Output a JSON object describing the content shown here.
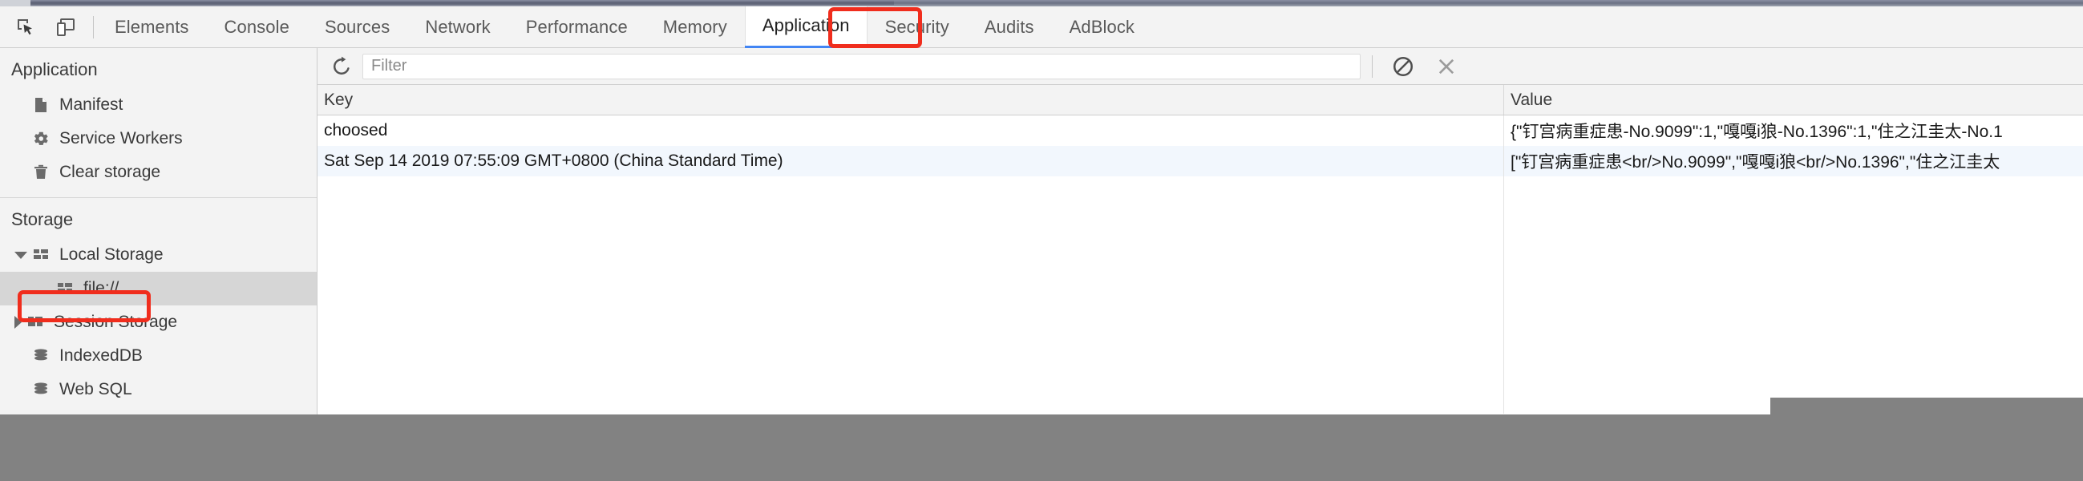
{
  "toolbar": {
    "inspect_icon": "inspect-element-icon",
    "device_icon": "toggle-device-toolbar-icon"
  },
  "tabs": [
    {
      "label": "Elements",
      "selected": false
    },
    {
      "label": "Console",
      "selected": false
    },
    {
      "label": "Sources",
      "selected": false
    },
    {
      "label": "Network",
      "selected": false
    },
    {
      "label": "Performance",
      "selected": false
    },
    {
      "label": "Memory",
      "selected": false
    },
    {
      "label": "Application",
      "selected": true
    },
    {
      "label": "Security",
      "selected": false
    },
    {
      "label": "Audits",
      "selected": false
    },
    {
      "label": "AdBlock",
      "selected": false
    }
  ],
  "sidebar": {
    "application": {
      "title": "Application",
      "items": [
        {
          "label": "Manifest",
          "icon": "document-icon"
        },
        {
          "label": "Service Workers",
          "icon": "gear-icon"
        },
        {
          "label": "Clear storage",
          "icon": "trash-icon"
        }
      ]
    },
    "storage": {
      "title": "Storage",
      "items": [
        {
          "label": "Local Storage",
          "icon": "table-icon",
          "twisty": "open",
          "child": false,
          "selected": false
        },
        {
          "label": "file://",
          "icon": "table-icon",
          "twisty": "none",
          "child": true,
          "selected": true
        },
        {
          "label": "Session Storage",
          "icon": "table-icon",
          "twisty": "closed",
          "child": false,
          "selected": false
        },
        {
          "label": "IndexedDB",
          "icon": "database-icon",
          "twisty": "none",
          "child": false,
          "selected": false
        },
        {
          "label": "Web SQL",
          "icon": "database-icon",
          "twisty": "none",
          "child": false,
          "selected": false
        }
      ]
    }
  },
  "filterbar": {
    "refresh_icon": "refresh-icon",
    "placeholder": "Filter",
    "value": "",
    "clear_all_icon": "clear-all-icon",
    "delete_selected_icon": "delete-selected-icon"
  },
  "table": {
    "columns": [
      "Key",
      "Value"
    ],
    "rows": [
      {
        "key": "choosed",
        "value": "{\"钉宫病重症患-No.9099\":1,\"嘎嘎i狼-No.1396\":1,\"住之江圭太-No.1"
      },
      {
        "key": "Sat Sep 14 2019 07:55:09 GMT+0800 (China Standard Time)",
        "value": "[\"钉宫病重症患<br/>No.9099\",\"嘎嘎i狼<br/>No.1396\",\"住之江圭太"
      }
    ]
  },
  "annotations": [
    {
      "name": "application-tab-highlight",
      "color": "#f02d1d"
    },
    {
      "name": "file-url-highlight",
      "color": "#f02d1d"
    }
  ]
}
